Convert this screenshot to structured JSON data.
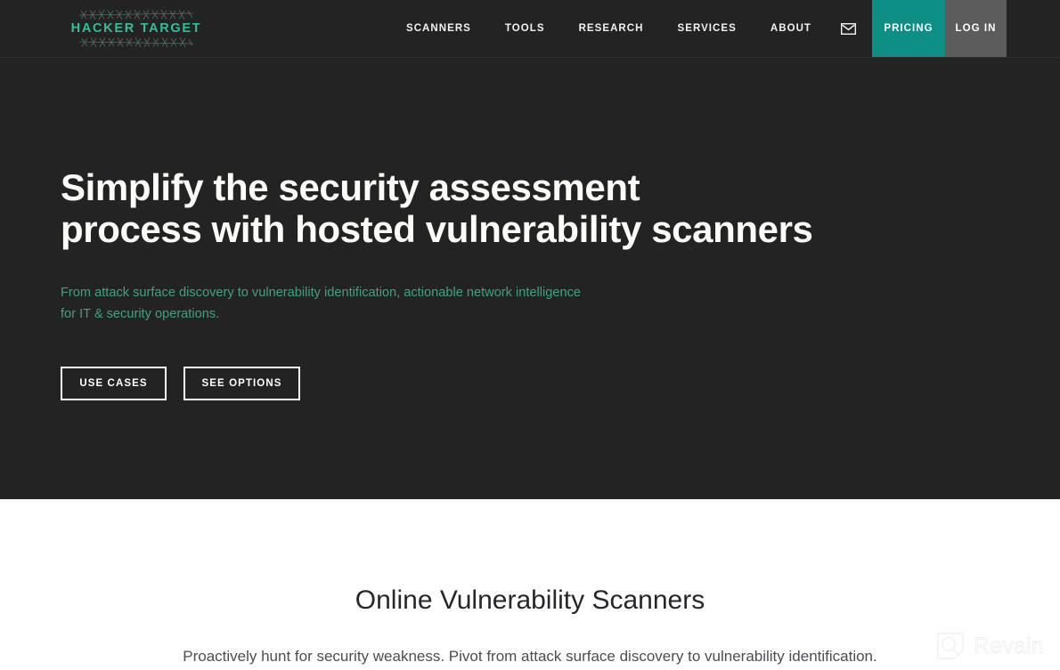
{
  "header": {
    "logo": {
      "text": "HACKER TARGET",
      "color": "#2fbf9a",
      "icon": "barbed-wire-ornament"
    },
    "nav_items": [
      {
        "label": "SCANNERS"
      },
      {
        "label": "TOOLS"
      },
      {
        "label": "RESEARCH"
      },
      {
        "label": "SERVICES"
      },
      {
        "label": "ABOUT"
      }
    ],
    "mail_icon": "envelope-icon",
    "cta": [
      {
        "label": "PRICING",
        "bg": "#0d8f85"
      },
      {
        "label": "LOG IN",
        "bg": "#5c5c5c"
      }
    ],
    "bg": "#232323"
  },
  "hero": {
    "title_line1": "Simplify the security assessment",
    "title_line2": "process with hosted vulnerability scanners",
    "subtitle_line1": "From attack surface discovery to vulnerability identification, actionable network intelligence",
    "subtitle_line2": "for IT & security operations.",
    "subtitle_color": "#3ea37d",
    "buttons": [
      {
        "label": "USE CASES"
      },
      {
        "label": "SEE OPTIONS"
      }
    ],
    "bg": "#232323"
  },
  "section": {
    "title": "Online Vulnerability Scanners",
    "description": "Proactively hunt for security weakness. Pivot from attack surface discovery to vulnerability identification."
  },
  "watermark": {
    "text": "Revain",
    "icon": "revain-magnifier-logo"
  }
}
